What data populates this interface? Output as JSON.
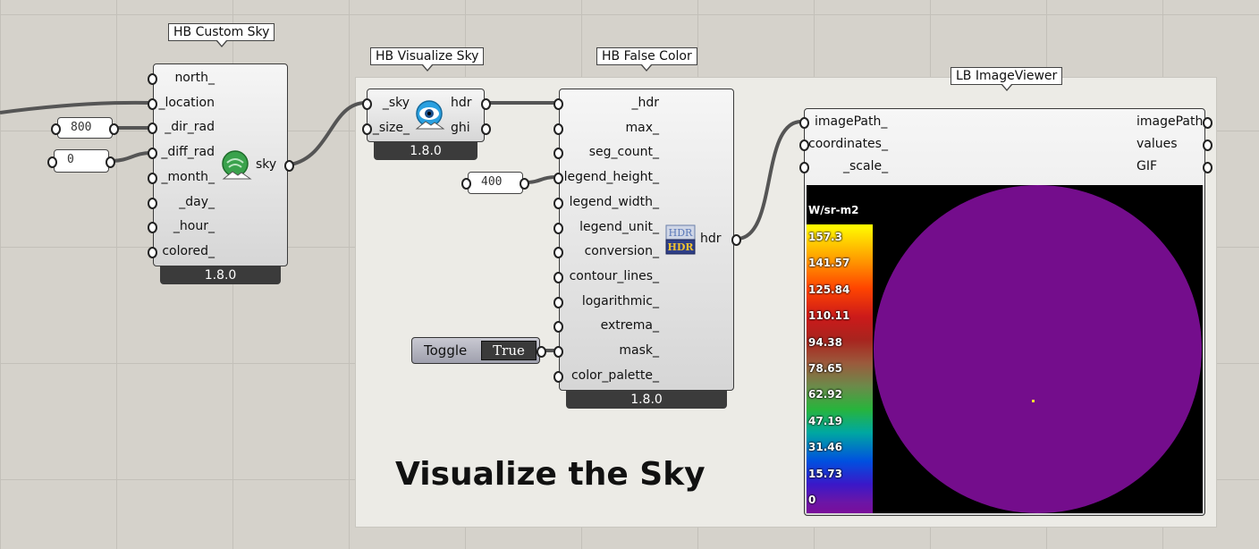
{
  "group": {
    "title": "Visualize the Sky"
  },
  "components": {
    "custom_sky": {
      "title": "HB Custom Sky",
      "inputs": [
        "north_",
        "_location",
        "_dir_rad",
        "_diff_rad",
        "_month_",
        "_day_",
        "_hour_",
        "colored_"
      ],
      "output": "sky",
      "version": "1.8.0",
      "icon": "custom-sky-icon"
    },
    "visualize_sky": {
      "title": "HB Visualize Sky",
      "inputs": [
        "_sky",
        "_size_"
      ],
      "outputs": [
        "hdr",
        "ghi"
      ],
      "version": "1.8.0",
      "icon": "eye-sky-icon"
    },
    "false_color": {
      "title": "HB False Color",
      "inputs": [
        "_hdr",
        "max_",
        "seg_count_",
        "legend_height_",
        "legend_width_",
        "legend_unit_",
        "conversion_",
        "contour_lines_",
        "logarithmic_",
        "extrema_",
        "mask_",
        "color_palette_"
      ],
      "output": "hdr",
      "version": "1.8.0",
      "icon": "hdr-icon",
      "icon_text_top": "HDR",
      "icon_text_bottom": "HDR"
    },
    "image_viewer": {
      "title": "LB ImageViewer",
      "inputs": [
        "imagePath_",
        "coordinates_",
        "_scale_"
      ],
      "outputs": [
        "imagePath",
        "values",
        "GIF"
      ]
    }
  },
  "panels": {
    "dir_rad": "800",
    "diff_rad": "0",
    "legend_height": "400"
  },
  "toggle": {
    "label": "Toggle",
    "value": "True"
  },
  "viewer_image": {
    "unit": "W/sr-m2",
    "legend_values": [
      "157.3",
      "141.57",
      "125.84",
      "110.11",
      "94.38",
      "78.65",
      "62.92",
      "47.19",
      "31.46",
      "15.73",
      "0"
    ]
  },
  "colors": {
    "canvas": "#d5d2cb",
    "group": "#ecebe6",
    "wire": "#555555",
    "sky_disc": "#740d8c",
    "version_bar": "#3b3b3b"
  }
}
